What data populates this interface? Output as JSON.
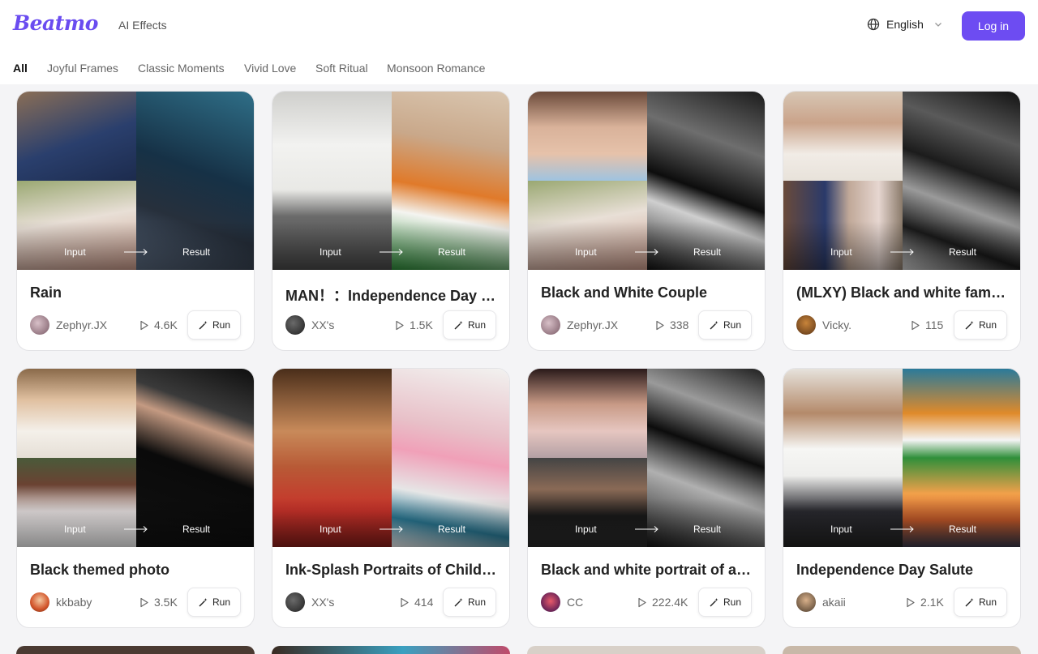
{
  "header": {
    "logo": "Beatmo",
    "nav_link": "AI Effects",
    "language": "English",
    "login_label": "Log in",
    "accent_color": "#6d4cf2"
  },
  "categories": [
    "All",
    "Joyful Frames",
    "Classic Moments",
    "Vivid Love",
    "Soft Ritual",
    "Monsoon Romance"
  ],
  "active_category": "All",
  "card_labels": {
    "input": "Input",
    "result": "Result",
    "run": "Run"
  },
  "cards": [
    {
      "title": "Rain",
      "author": "Zephyr.JX",
      "plays": "4.6K"
    },
    {
      "title": "MAN！：Independence Day …",
      "author": "XX's",
      "plays": "1.5K"
    },
    {
      "title": "Black and White Couple",
      "author": "Zephyr.JX",
      "plays": "338"
    },
    {
      "title": "(MLXY) Black and white fam…",
      "author": "Vicky.",
      "plays": "115"
    },
    {
      "title": "Black themed photo",
      "author": "kkbaby",
      "plays": "3.5K"
    },
    {
      "title": "Ink-Splash Portraits of Child…",
      "author": "XX's",
      "plays": "414"
    },
    {
      "title": "Black and white portrait of a…",
      "author": "CC",
      "plays": "222.4K"
    },
    {
      "title": "Independence Day Salute",
      "author": "akaii",
      "plays": "2.1K"
    }
  ]
}
